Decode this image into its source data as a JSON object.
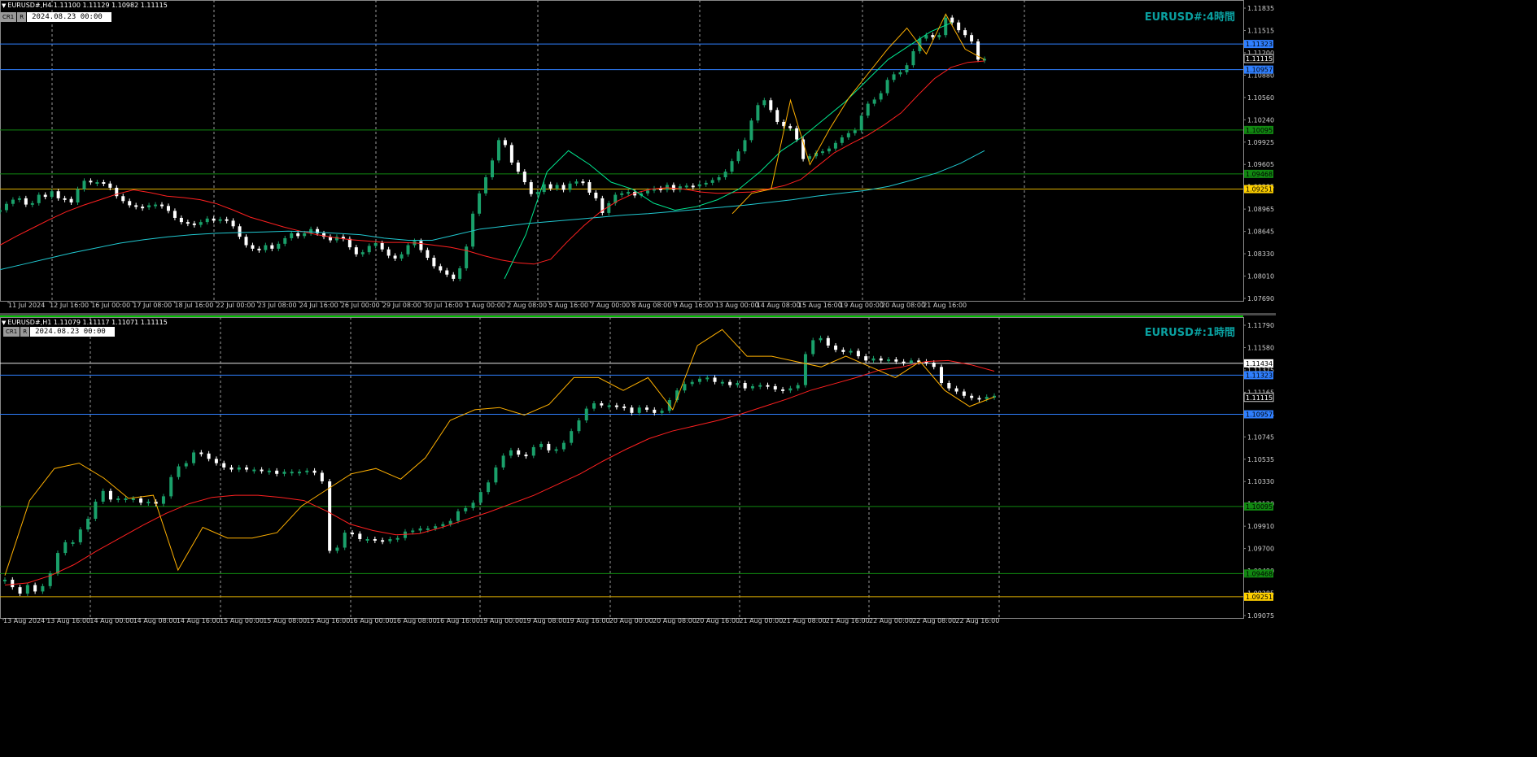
{
  "panes": [
    {
      "header": "EURUSD#,H4  1.11100 1.11129 1.10982 1.11115",
      "cr_label": "CR1",
      "r_label": "R",
      "date_value": "2024.08.23 00:00",
      "symbol_label": "EURUSD#:4時間",
      "ticks_y": [
        "1.11835",
        "1.11515",
        "1.11200",
        "1.10880",
        "1.10560",
        "1.10240",
        "1.09925",
        "1.09605",
        "1.09285",
        "1.08965",
        "1.08645",
        "1.08330",
        "1.08010",
        "1.07690"
      ],
      "ticks_x": [
        "11 Jul 2024",
        "12 Jul 16:00",
        "16 Jul 00:00",
        "17 Jul 08:00",
        "18 Jul 16:00",
        "22 Jul 00:00",
        "23 Jul 08:00",
        "24 Jul 16:00",
        "26 Jul 00:00",
        "29 Jul 08:00",
        "30 Jul 16:00",
        "1 Aug 00:00",
        "2 Aug 08:00",
        "5 Aug 16:00",
        "7 Aug 00:00",
        "8 Aug 08:00",
        "9 Aug 16:00",
        "13 Aug 00:00",
        "14 Aug 08:00",
        "15 Aug 16:00",
        "19 Aug 00:00",
        "20 Aug 08:00",
        "21 Aug 16:00"
      ],
      "levels": [
        {
          "value": "1.11323",
          "color": "#2f7fff",
          "tag": "#2f7fff"
        },
        {
          "value": "1.10957",
          "color": "#2f7fff",
          "tag": "#2f7fff"
        },
        {
          "value": "1.10095",
          "color": "#118811",
          "tag": "#118811"
        },
        {
          "value": "1.09468",
          "color": "#118811",
          "tag": "#118811"
        },
        {
          "value": "1.09251",
          "color": "#e0b000",
          "tag": "#ffd000"
        }
      ],
      "current_price": "1.11115"
    },
    {
      "header": "EURUSD#,H1  1.11079 1.11117 1.11071 1.11115",
      "cr_label": "CR1",
      "r_label": "R",
      "date_value": "2024.08.23 00:00",
      "symbol_label": "EURUSD#:1時間",
      "ticks_y": [
        "1.11790",
        "1.11580",
        "1.11375",
        "1.11165",
        "1.10955",
        "1.10745",
        "1.10535",
        "1.10330",
        "1.10120",
        "1.09910",
        "1.09700",
        "1.09490",
        "1.09285",
        "1.09075"
      ],
      "ticks_x": [
        "13 Aug 2024",
        "13 Aug 16:00",
        "14 Aug 00:00",
        "14 Aug 08:00",
        "14 Aug 16:00",
        "15 Aug 00:00",
        "15 Aug 08:00",
        "15 Aug 16:00",
        "16 Aug 00:00",
        "16 Aug 08:00",
        "16 Aug 16:00",
        "19 Aug 00:00",
        "19 Aug 08:00",
        "19 Aug 16:00",
        "20 Aug 00:00",
        "20 Aug 08:00",
        "20 Aug 16:00",
        "21 Aug 00:00",
        "21 Aug 08:00",
        "21 Aug 16:00",
        "22 Aug 00:00",
        "22 Aug 08:00",
        "22 Aug 16:00"
      ],
      "levels": [
        {
          "value": "1.11434",
          "color": "#e6e6e6",
          "tag": "#ffffff"
        },
        {
          "value": "1.11323",
          "color": "#2f7fff",
          "tag": "#2f7fff"
        },
        {
          "value": "1.10957",
          "color": "#2f7fff",
          "tag": "#2f7fff"
        },
        {
          "value": "1.10095",
          "color": "#118811",
          "tag": "#118811"
        },
        {
          "value": "1.09468",
          "color": "#118811",
          "tag": "#118811"
        },
        {
          "value": "1.09251",
          "color": "#e0b000",
          "tag": "#ffd000"
        }
      ],
      "current_price": "1.11115"
    }
  ],
  "chart_data": [
    {
      "type": "line",
      "ylim": [
        1.0769,
        1.11835
      ],
      "series": [
        {
          "color": "#ffffff",
          "values": [
            1.0895,
            1.0904,
            1.091,
            1.0912,
            1.0903,
            1.0905,
            1.0917,
            1.0914,
            1.0922,
            1.0912,
            1.0911,
            1.0906,
            1.0925,
            1.0937,
            1.0935,
            1.0935,
            1.0933,
            1.0927,
            1.0915,
            1.0908,
            1.0902,
            1.09,
            1.0899,
            1.0902,
            1.0903,
            1.0901,
            1.0894,
            1.0884,
            1.0878,
            1.0876,
            1.0874,
            1.0878,
            1.0883,
            1.088,
            1.0882,
            1.088,
            1.0872,
            1.0857,
            1.0845,
            1.084,
            1.0838,
            1.0845,
            1.084,
            1.0847,
            1.0855,
            1.0862,
            1.0858,
            1.0862,
            1.0868,
            1.0862,
            1.0857,
            1.0852,
            1.0857,
            1.0854,
            1.0842,
            1.0832,
            1.0835,
            1.0844,
            1.0848,
            1.0839,
            1.083,
            1.0826,
            1.0832,
            1.0845,
            1.0851,
            1.0838,
            1.0827,
            1.0815,
            1.0809,
            1.0803,
            1.0797,
            1.0812,
            1.0843,
            1.089,
            1.0919,
            1.0942,
            1.0966,
            1.0995,
            1.0988,
            1.0963,
            1.095,
            1.0935,
            1.0918,
            1.0921,
            1.0932,
            1.0926,
            1.0931,
            1.0924,
            1.0933,
            1.0936,
            1.0935,
            1.092,
            1.0912,
            1.0891,
            1.0905,
            1.0917,
            1.0919,
            1.0921,
            1.0916,
            1.0919,
            1.0923,
            1.0926,
            1.0924,
            1.0931,
            1.0924,
            1.0929,
            1.093,
            1.0929,
            1.0932,
            1.0934,
            1.0938,
            1.0942,
            1.095,
            1.0965,
            1.0979,
            1.0995,
            1.1023,
            1.1045,
            1.1052,
            1.1038,
            1.1021,
            1.1015,
            1.1012,
            1.0996,
            1.0968,
            1.0972,
            1.0977,
            1.0979,
            1.0983,
            1.0991,
            1.0999,
            1.1005,
            1.1009,
            1.103,
            1.1047,
            1.1053,
            1.1062,
            1.1081,
            1.1089,
            1.1092,
            1.1102,
            1.1122,
            1.114,
            1.1145,
            1.1142,
            1.1145,
            1.117,
            1.1163,
            1.1152,
            1.1145,
            1.1136,
            1.111,
            1.1111
          ]
        },
        {
          "color": "#ff2020",
          "values": [
            1.0845,
            1.0858,
            1.087,
            1.0882,
            1.0893,
            1.0902,
            1.091,
            1.0918,
            1.0924,
            1.092,
            1.0915,
            1.0913,
            1.091,
            1.0904,
            1.0895,
            1.0885,
            1.0878,
            1.0871,
            1.0865,
            1.086,
            1.0856,
            1.0853,
            1.0851,
            1.0849,
            1.0849,
            1.0848,
            1.0845,
            1.0842,
            1.0837,
            1.083,
            1.0824,
            1.082,
            1.0818,
            1.0825,
            1.085,
            1.0873,
            1.0893,
            1.0908,
            1.0919,
            1.0925,
            1.0927,
            1.0925,
            1.0921,
            1.0919,
            1.092,
            1.0921,
            1.0925,
            1.093,
            1.0939,
            1.0958,
            1.0977,
            1.099,
            1.1002,
            1.1017,
            1.1034,
            1.1059,
            1.1083,
            1.1099,
            1.1106,
            1.1108
          ]
        },
        {
          "color": "#20c8d0",
          "values": [
            1.081,
            1.0818,
            1.0826,
            1.0834,
            1.0841,
            1.0848,
            1.0853,
            1.0857,
            1.086,
            1.0862,
            1.0863,
            1.0864,
            1.0865,
            1.0864,
            1.0862,
            1.086,
            1.0855,
            1.0852,
            1.0852,
            1.086,
            1.0868,
            1.0872,
            1.0876,
            1.0879,
            1.0882,
            1.0885,
            1.0888,
            1.089,
            1.0893,
            1.0896,
            1.0899,
            1.0902,
            1.0906,
            1.091,
            1.0915,
            1.0919,
            1.0923,
            1.0929,
            1.0938,
            1.0948,
            1.0962,
            1.098
          ]
        },
        {
          "color": "#00e890",
          "values": [
            1.0797,
            1.086,
            1.095,
            1.098,
            1.096,
            1.0935,
            1.0925,
            1.0905,
            1.0895,
            1.09,
            1.091,
            1.0925,
            1.095,
            1.098,
            1.1,
            1.1025,
            1.105,
            1.108,
            1.111,
            1.113,
            1.115,
            1.1163
          ]
        },
        {
          "color": "#ffb000",
          "values": [
            1.089,
            1.0919,
            1.0925,
            1.1052,
            1.096,
            1.101,
            1.1055,
            1.109,
            1.1125,
            1.1155,
            1.1118,
            1.1175,
            1.1125,
            1.111
          ]
        }
      ]
    },
    {
      "type": "line",
      "ylim": [
        1.09075,
        1.1179
      ],
      "series": [
        {
          "color": "#ffffff",
          "values": [
            1.0941,
            1.0934,
            1.0928,
            1.0936,
            1.093,
            1.0935,
            1.0947,
            1.0966,
            1.0976,
            1.0976,
            1.0988,
            1.0998,
            1.1014,
            1.1024,
            1.1016,
            1.1017,
            1.1017,
            1.1017,
            1.1013,
            1.1014,
            1.1012,
            1.1019,
            1.1037,
            1.1047,
            1.105,
            1.106,
            1.1059,
            1.1054,
            1.105,
            1.1046,
            1.1044,
            1.1046,
            1.1044,
            1.1044,
            1.1043,
            1.1043,
            1.104,
            1.1042,
            1.1042,
            1.1042,
            1.1043,
            1.1041,
            1.1033,
            1.0968,
            1.0971,
            1.0985,
            1.0984,
            1.0979,
            1.0979,
            1.0978,
            1.0977,
            1.0979,
            1.098,
            1.0986,
            1.0987,
            1.0989,
            1.0989,
            1.0991,
            1.0993,
            1.0996,
            1.1005,
            1.1008,
            1.1013,
            1.1023,
            1.1032,
            1.1046,
            1.1057,
            1.1062,
            1.1058,
            1.1057,
            1.1065,
            1.1068,
            1.1062,
            1.1063,
            1.1069,
            1.108,
            1.109,
            1.1101,
            1.1106,
            1.1104,
            1.1104,
            1.1103,
            1.1102,
            1.1097,
            1.1102,
            1.11,
            1.1097,
            1.1099,
            1.1109,
            1.1118,
            1.1124,
            1.1126,
            1.1129,
            1.113,
            1.1126,
            1.1126,
            1.1123,
            1.1125,
            1.112,
            1.1122,
            1.1123,
            1.1122,
            1.1119,
            1.1118,
            1.112,
            1.1123,
            1.1152,
            1.1165,
            1.1167,
            1.116,
            1.1156,
            1.1154,
            1.1155,
            1.115,
            1.1146,
            1.1148,
            1.1146,
            1.1147,
            1.1145,
            1.1144,
            1.1146,
            1.1145,
            1.1144,
            1.114,
            1.1125,
            1.112,
            1.1117,
            1.1113,
            1.1111,
            1.111,
            1.1112,
            1.1113
          ]
        },
        {
          "color": "#ff2020",
          "values": [
            1.0936,
            1.0938,
            1.0945,
            1.0955,
            1.0968,
            1.098,
            1.0992,
            1.1003,
            1.1012,
            1.1018,
            1.102,
            1.102,
            1.1018,
            1.1015,
            1.1005,
            1.0993,
            1.0987,
            1.0983,
            1.0984,
            1.099,
            1.0997,
            1.1004,
            1.1012,
            1.102,
            1.103,
            1.104,
            1.1052,
            1.1063,
            1.1073,
            1.108,
            1.1085,
            1.109,
            1.1096,
            1.1103,
            1.111,
            1.1118,
            1.1124,
            1.113,
            1.1137,
            1.114,
            1.1145,
            1.1146,
            1.1142,
            1.1136
          ]
        },
        {
          "color": "#ffb000",
          "values": [
            1.0945,
            1.1015,
            1.1045,
            1.105,
            1.1036,
            1.1017,
            1.102,
            1.095,
            1.099,
            1.098,
            1.098,
            1.0985,
            1.101,
            1.1025,
            1.104,
            1.1045,
            1.1035,
            1.1055,
            1.109,
            1.11,
            1.1102,
            1.1095,
            1.1105,
            1.113,
            1.113,
            1.1118,
            1.113,
            1.11,
            1.116,
            1.1175,
            1.115,
            1.115,
            1.1145,
            1.114,
            1.115,
            1.114,
            1.113,
            1.1145,
            1.1118,
            1.1103,
            1.1112
          ]
        }
      ]
    }
  ]
}
